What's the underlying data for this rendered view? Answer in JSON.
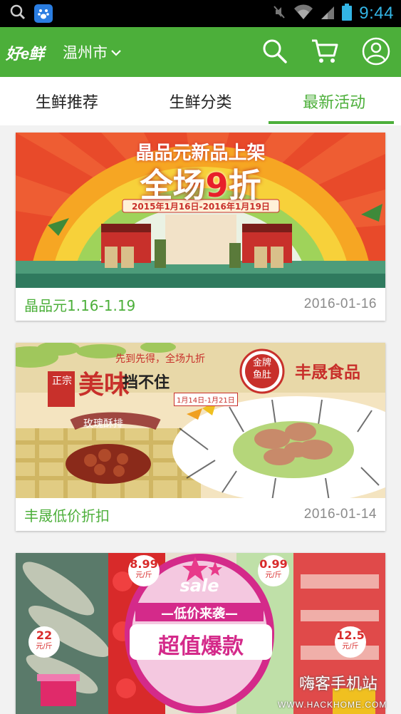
{
  "status_bar": {
    "time": "9:44"
  },
  "header": {
    "logo": "好e鲜",
    "city": "温州市",
    "icons": [
      "search-icon",
      "cart-icon",
      "user-icon"
    ]
  },
  "tabs": [
    {
      "label": "生鲜推荐",
      "active": false
    },
    {
      "label": "生鲜分类",
      "active": false
    },
    {
      "label": "最新活动",
      "active": true
    }
  ],
  "cards": [
    {
      "title": "晶品元1.16-1.19",
      "date": "2016-01-16",
      "banner": {
        "headline": "晶品元新品上架",
        "big_pre": "全场",
        "big_num": "9",
        "big_post": "折",
        "dates": "2015年1月16日-2016年1月19日"
      }
    },
    {
      "title": "丰晟低价折扣",
      "date": "2016-01-14",
      "banner": {
        "brand": "丰晟食品",
        "tag_a": "正宗",
        "tag_b": "美味",
        "line1": "先到先得，全场九折",
        "line2": "挡不住",
        "dates": "1月14日-1月21日",
        "product": "玫瑰酥排",
        "badge": "金牌鱼肚"
      }
    },
    {
      "banner": {
        "sale": "sale",
        "line1": "—低价来袭—",
        "line2": "超值爆款",
        "price_a": "8.99",
        "price_a_unit": "元/斤",
        "price_b": "0.99",
        "price_b_unit": "元/斤",
        "price_c": "22",
        "price_c_unit": "元/斤",
        "price_d": "12.5",
        "price_d_unit": "元/斤"
      }
    }
  ],
  "watermark": {
    "cn": "嗨客手机站",
    "url": "WWW.HACKHOME.COM"
  }
}
